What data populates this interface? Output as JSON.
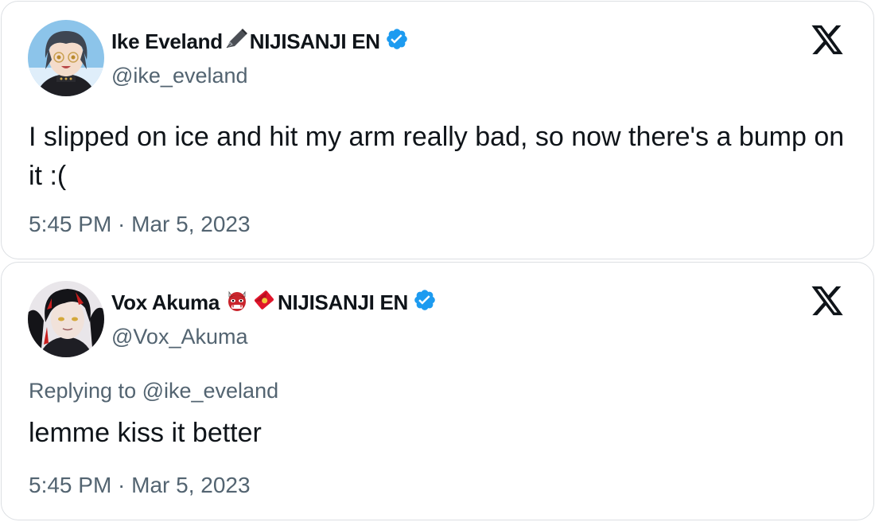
{
  "tweets": [
    {
      "display_name": "Ike Eveland",
      "name_suffix": "NIJISANJI EN",
      "name_emojis": [
        "fountain-pen"
      ],
      "verified": true,
      "handle": "@ike_eveland",
      "text": "I slipped on ice and hit my arm really bad, so now there's a bump on it :(",
      "timestamp": "5:45 PM · Mar 5, 2023",
      "avatar_colors": {
        "bg": "#7fb9e6",
        "hair": "#3e4652",
        "skin": "#f4dccb"
      }
    },
    {
      "display_name": "Vox Akuma",
      "name_suffix": "NIJISANJI EN",
      "name_emojis": [
        "ogre",
        "red-envelope"
      ],
      "verified": true,
      "handle": "@Vox_Akuma",
      "reply_to": "Replying to @ike_eveland",
      "text": "lemme kiss it better",
      "timestamp": "5:45 PM · Mar 5, 2023",
      "avatar_colors": {
        "bg": "#1a1a1f",
        "hair": "#141418",
        "skin": "#f1e2da",
        "accent": "#c81e1e"
      }
    }
  ],
  "colors": {
    "text": "#0f1419",
    "secondary": "#536471",
    "verified": "#1d9bf0",
    "border": "#dcdfe3"
  },
  "icons": {
    "platform": "x-logo-icon"
  }
}
